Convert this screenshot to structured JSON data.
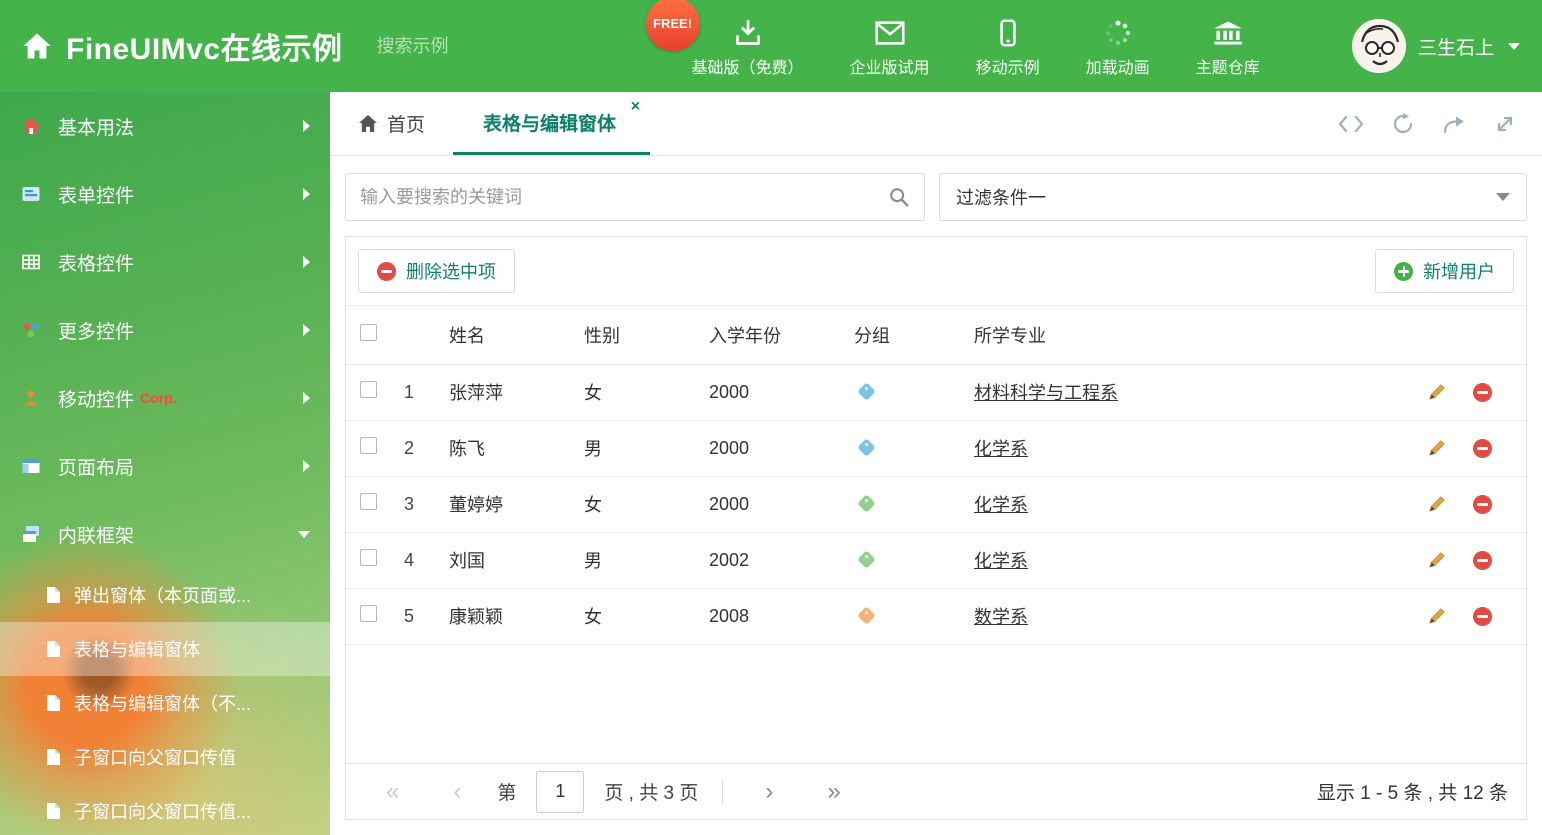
{
  "colors": {
    "header_green": "#44b44a",
    "accent_teal": "#0e7f6a",
    "danger_red": "#e14c42",
    "add_green": "#43b244",
    "pencil_orange": "#e9a13b"
  },
  "header": {
    "brand": "FineUIMvc在线示例",
    "search_placeholder": "搜索示例",
    "free_badge": "FREE!",
    "nav_items": [
      {
        "label": "基础版（免费）",
        "icon": "download-icon"
      },
      {
        "label": "企业版试用",
        "icon": "envelope-icon"
      },
      {
        "label": "移动示例",
        "icon": "mobile-icon"
      },
      {
        "label": "加载动画",
        "icon": "spinner-icon"
      },
      {
        "label": "主题仓库",
        "icon": "bank-icon"
      }
    ],
    "username": "三生石上"
  },
  "sidebar": {
    "items": [
      {
        "label": "基本用法",
        "icon": "home-icon"
      },
      {
        "label": "表单控件",
        "icon": "form-icon"
      },
      {
        "label": "表格控件",
        "icon": "table-icon"
      },
      {
        "label": "更多控件",
        "icon": "more-controls-icon"
      },
      {
        "label": "移动控件",
        "icon": "mobile-person-icon",
        "badge": "Corp."
      },
      {
        "label": "页面布局",
        "icon": "layout-icon"
      },
      {
        "label": "内联框架",
        "icon": "iframe-icon",
        "expanded": true
      }
    ],
    "subitems": [
      {
        "label": "弹出窗体（本页面或..."
      },
      {
        "label": "表格与编辑窗体",
        "active": true
      },
      {
        "label": "表格与编辑窗体（不..."
      },
      {
        "label": "子窗口向父窗口传值"
      },
      {
        "label": "子窗口向父窗口传值..."
      }
    ]
  },
  "tabs": {
    "home_label": "首页",
    "active_label": "表格与编辑窗体"
  },
  "filters": {
    "search_placeholder": "输入要搜索的关键词",
    "dropdown_value": "过滤条件一"
  },
  "grid": {
    "toolbar": {
      "delete_label": "删除选中项",
      "add_label": "新增用户"
    },
    "columns": {
      "name": "姓名",
      "gender": "性别",
      "year": "入学年份",
      "group": "分组",
      "major": "所学专业"
    },
    "rows": [
      {
        "index": "1",
        "name": "张萍萍",
        "gender": "女",
        "year": "2000",
        "tag_color": "#7dc3e8",
        "major": "材料科学与工程系"
      },
      {
        "index": "2",
        "name": "陈飞",
        "gender": "男",
        "year": "2000",
        "tag_color": "#7dc3e8",
        "major": "化学系"
      },
      {
        "index": "3",
        "name": "董婷婷",
        "gender": "女",
        "year": "2000",
        "tag_color": "#93cf93",
        "major": "化学系"
      },
      {
        "index": "4",
        "name": "刘国",
        "gender": "男",
        "year": "2002",
        "tag_color": "#93cf93",
        "major": "化学系"
      },
      {
        "index": "5",
        "name": "康颖颖",
        "gender": "女",
        "year": "2008",
        "tag_color": "#f3b077",
        "major": "数学系"
      }
    ],
    "pagination": {
      "prefix": "第",
      "page": "1",
      "suffix": "页 , 共 3 页",
      "summary": "显示 1 - 5 条 , 共 12 条"
    }
  },
  "icons": {
    "first": "«",
    "prev": "‹",
    "next": "›",
    "last": "»",
    "close": "×"
  }
}
